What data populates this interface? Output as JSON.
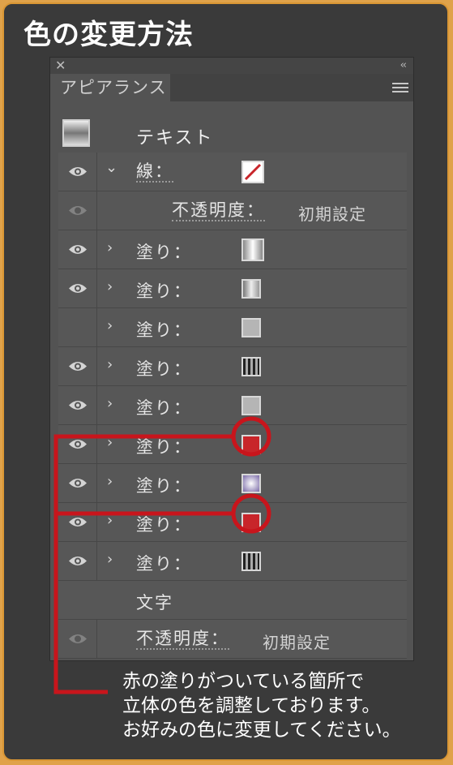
{
  "title": "色の変更方法",
  "panel": {
    "close_glyph": "✕",
    "collapse_glyph": "‹‹",
    "tab_label": "アピアランス"
  },
  "rows": {
    "text_object": "テキスト",
    "stroke": "線：",
    "stroke_opacity_label": "不透明度：",
    "stroke_opacity_value": "初期設定",
    "fill_label": "塗り：",
    "character": "文字",
    "char_opacity_label": "不透明度：",
    "char_opacity_value": "初期設定"
  },
  "swatch_colors": {
    "red": "#c8252a",
    "gray": "#b5b5b5",
    "highlight_ring": "#c8151c"
  },
  "caption": {
    "line1": "赤の塗りがついている箇所で",
    "line2": "立体の色を調整しております。",
    "line3": "お好みの色に変更してください。"
  }
}
